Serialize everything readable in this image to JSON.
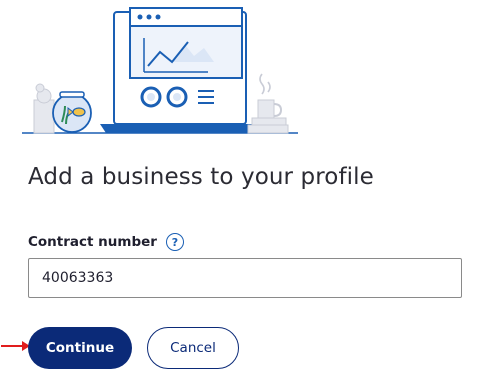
{
  "page": {
    "title": "Add a business to your profile"
  },
  "form": {
    "contract_label": "Contract number",
    "contract_value": "40063363",
    "help_glyph": "?"
  },
  "actions": {
    "continue_label": "Continue",
    "cancel_label": "Cancel"
  },
  "icons": {
    "illustration": "laptop-dashboard-illustration",
    "help": "help-icon",
    "arrow": "arrow-right-icon"
  },
  "colors": {
    "primary": "#0b2a78",
    "accent": "#1a5fb4",
    "annotation": "#e11d1d",
    "illustration_fill": "#dbe6f6"
  }
}
